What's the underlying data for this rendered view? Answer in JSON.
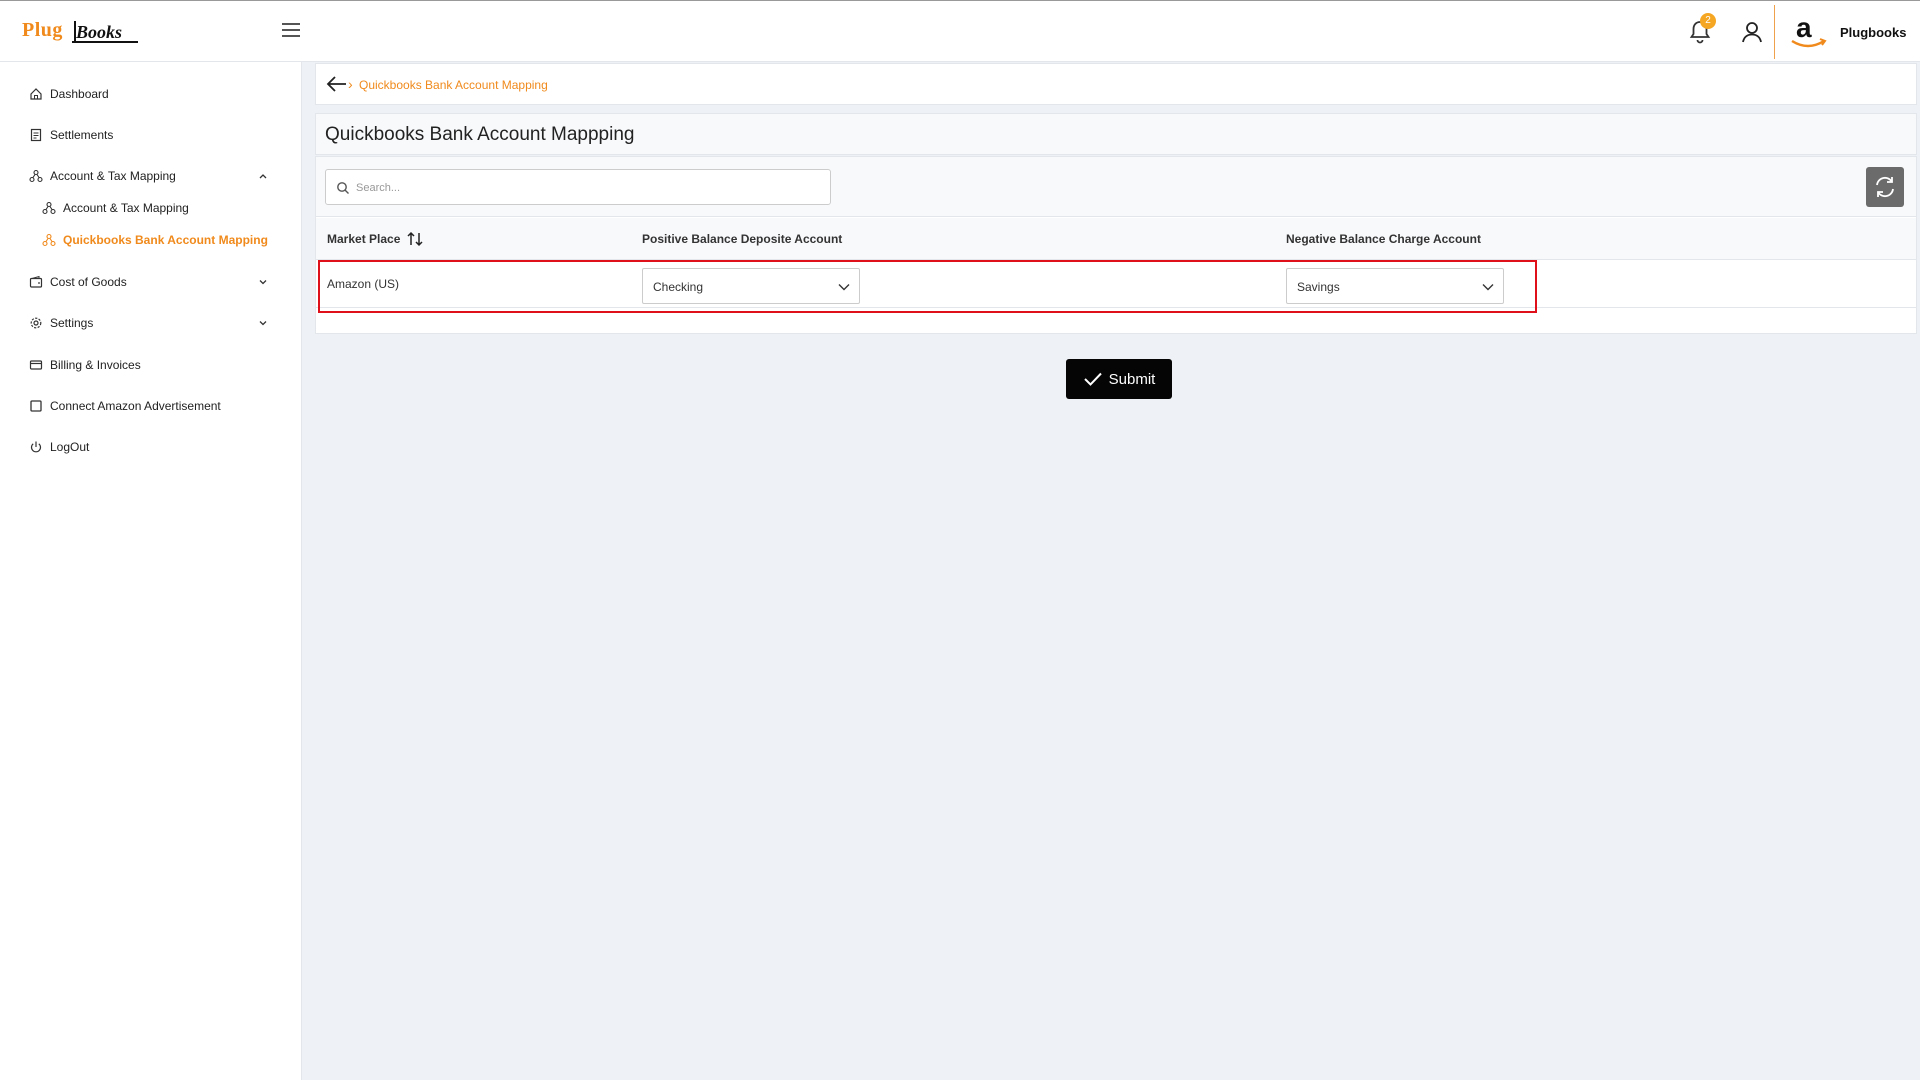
{
  "brand": {
    "logo_part1": "Plug",
    "logo_part2": "Books"
  },
  "header": {
    "notification_count": "2",
    "account_name": "Plugbooks",
    "accent_color": "#f08a1c"
  },
  "sidebar": {
    "items": [
      {
        "label": "Dashboard",
        "icon": "home-icon"
      },
      {
        "label": "Settlements",
        "icon": "receipt-icon"
      },
      {
        "label": "Account & Tax Mapping",
        "icon": "sitemap-icon",
        "expanded": true
      },
      {
        "label": "Account & Tax Mapping",
        "icon": "sitemap-icon",
        "sub": true
      },
      {
        "label": "Quickbooks Bank Account Mapping",
        "icon": "sitemap-icon",
        "sub": true,
        "active": true
      },
      {
        "label": "Cost of Goods",
        "icon": "wallet-icon",
        "expandable": true
      },
      {
        "label": "Settings",
        "icon": "gear-icon",
        "expandable": true
      },
      {
        "label": "Billing & Invoices",
        "icon": "card-icon"
      },
      {
        "label": "Connect Amazon Advertisement",
        "icon": "square-icon"
      },
      {
        "label": "LogOut",
        "icon": "power-icon"
      }
    ]
  },
  "breadcrumb": {
    "current": "Quickbooks Bank Account Mapping"
  },
  "page": {
    "title": "Quickbooks Bank Account Mappping"
  },
  "search": {
    "placeholder": "Search...",
    "value": ""
  },
  "table": {
    "columns": [
      "Market Place",
      "Positive Balance Deposite Account",
      "Negative Balance Charge Account"
    ],
    "rows": [
      {
        "marketplace": "Amazon (US)",
        "positive": "Checking",
        "negative": "Savings"
      }
    ]
  },
  "actions": {
    "submit_label": "Submit"
  }
}
